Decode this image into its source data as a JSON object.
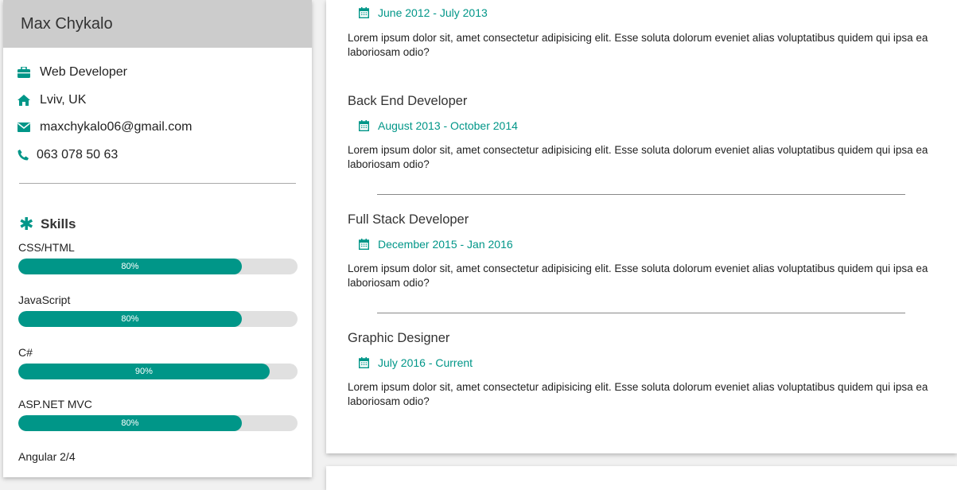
{
  "profile": {
    "name": "Max Chykalo",
    "job_title": "Web Developer",
    "location": "Lviv, UK",
    "email": "maxchykalo06@gmail.com",
    "phone": "063 078 50 63"
  },
  "skills": {
    "title": "Skills",
    "items": [
      {
        "name": "CSS/HTML",
        "percent": 80,
        "label": "80%"
      },
      {
        "name": "JavaScript",
        "percent": 80,
        "label": "80%"
      },
      {
        "name": "C#",
        "percent": 90,
        "label": "90%"
      },
      {
        "name": "ASP.NET MVC",
        "percent": 80,
        "label": "80%"
      },
      {
        "name": "Angular 2/4",
        "percent": null,
        "label": ""
      }
    ]
  },
  "experience": [
    {
      "title": "",
      "date": "June 2012 - July 2013",
      "desc": "Lorem ipsum dolor sit, amet consectetur adipisicing elit. Esse soluta dolorum eveniet alias voluptatibus quidem qui ipsa ea laboriosam odio?"
    },
    {
      "title": "Back End Developer",
      "date": "August 2013 - October 2014",
      "desc": "Lorem ipsum dolor sit, amet consectetur adipisicing elit. Esse soluta dolorum eveniet alias voluptatibus quidem qui ipsa ea laboriosam odio?"
    },
    {
      "title": "Full Stack Developer",
      "date": "December 2015 - Jan 2016",
      "desc": "Lorem ipsum dolor sit, amet consectetur adipisicing elit. Esse soluta dolorum eveniet alias voluptatibus quidem qui ipsa ea laboriosam odio?"
    },
    {
      "title": "Graphic Designer",
      "date": "July 2016 - Current",
      "desc": "Lorem ipsum dolor sit, amet consectetur adipisicing elit. Esse soluta dolorum eveniet alias voluptatibus quidem qui ipsa ea laboriosam odio?"
    }
  ],
  "colors": {
    "accent": "#009688",
    "header_bg": "#cccccc",
    "track": "#e0e0e0"
  },
  "icons": {
    "job": "briefcase-icon",
    "location": "home-icon",
    "email": "envelope-icon",
    "phone": "phone-icon",
    "skills": "asterisk-icon",
    "date": "calendar-icon"
  }
}
